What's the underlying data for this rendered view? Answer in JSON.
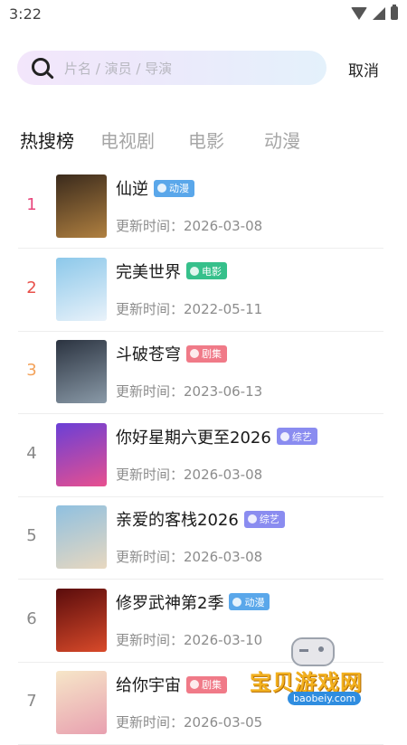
{
  "status_bar": {
    "time": "3:22"
  },
  "search": {
    "placeholder": "片名 / 演员 / 导演",
    "value": "",
    "cancel_label": "取消"
  },
  "tabs": [
    {
      "label": "热搜榜",
      "active": true
    },
    {
      "label": "电视剧",
      "active": false
    },
    {
      "label": "电影",
      "active": false
    },
    {
      "label": "动漫",
      "active": false
    }
  ],
  "list": [
    {
      "rank": "1",
      "rank_color": "#e8467c",
      "title": "仙逆",
      "badge": "动漫",
      "badge_color": "#5aa7ea",
      "update": "更新时间：2026-03-08",
      "poster_colors": [
        "#3a2a1c",
        "#b08040"
      ]
    },
    {
      "rank": "2",
      "rank_color": "#e8504a",
      "title": "完美世界",
      "badge": "电影",
      "badge_color": "#36c08b",
      "update": "更新时间：2022-05-11",
      "poster_colors": [
        "#8cc8ea",
        "#e9f2fa"
      ]
    },
    {
      "rank": "3",
      "rank_color": "#f3a25a",
      "title": "斗破苍穹",
      "badge": "剧集",
      "badge_color": "#f07a88",
      "update": "更新时间：2023-06-13",
      "poster_colors": [
        "#2b3340",
        "#8a9aa8"
      ]
    },
    {
      "rank": "4",
      "rank_color": "#888888",
      "title": "你好星期六更至2026",
      "badge": "综艺",
      "badge_color": "#8a8cf0",
      "update": "更新时间：2026-03-08",
      "poster_colors": [
        "#6a3fd6",
        "#e8508f"
      ]
    },
    {
      "rank": "5",
      "rank_color": "#888888",
      "title": "亲爱的客栈2026",
      "badge": "综艺",
      "badge_color": "#8a8cf0",
      "update": "更新时间：2026-03-08",
      "poster_colors": [
        "#8fc0e0",
        "#e8d8c0"
      ]
    },
    {
      "rank": "6",
      "rank_color": "#888888",
      "title": "修罗武神第2季",
      "badge": "动漫",
      "badge_color": "#5aa7ea",
      "update": "更新时间：2026-03-10",
      "poster_colors": [
        "#5a0c0c",
        "#d94a2a"
      ]
    },
    {
      "rank": "7",
      "rank_color": "#888888",
      "title": "给你宇宙",
      "badge": "剧集",
      "badge_color": "#f07a88",
      "update": "更新时间：2026-03-05",
      "poster_colors": [
        "#f6e6c8",
        "#e8a0b0"
      ]
    }
  ],
  "watermark": {
    "text": "宝贝游戏网",
    "url": "baobeiy.com"
  }
}
